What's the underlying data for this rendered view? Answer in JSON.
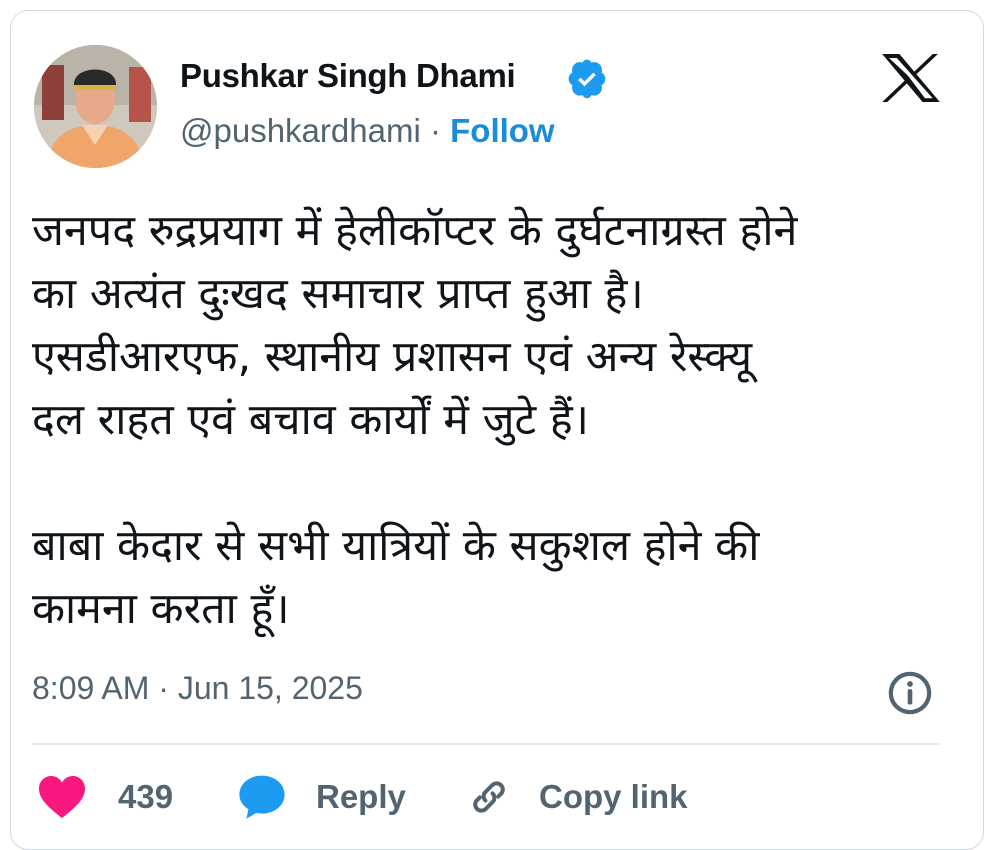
{
  "author": {
    "name": "Pushkar Singh Dhami",
    "handle": "@pushkardhami",
    "separator": "·",
    "follow_label": "Follow",
    "verified": true,
    "verified_color": "#1d9bf0"
  },
  "platform_icon": "x-logo-icon",
  "tweet": {
    "text": "जनपद रुद्रप्रयाग में हेलीकॉप्टर के दुर्घटनाग्रस्त होने\nका अत्यंत दुःखद समाचार प्राप्त हुआ है।\nएसडीआरएफ, स्थानीय प्रशासन एवं अन्य रेस्क्यू\nदल राहत एवं बचाव कार्यों में जुटे हैं।\n\nबाबा केदार से सभी यात्रियों के सकुशल होने की\nकामना करता हूँ।",
    "timestamp": "8:09 AM · Jun 15, 2025"
  },
  "actions": {
    "like_count": "439",
    "like_color": "#f91880",
    "reply_label": "Reply",
    "reply_color": "#1d9bf0",
    "copy_label": "Copy link"
  },
  "icons": {
    "info": "info-icon",
    "like": "heart-icon",
    "reply": "speech-bubble-icon",
    "copy": "link-icon"
  }
}
